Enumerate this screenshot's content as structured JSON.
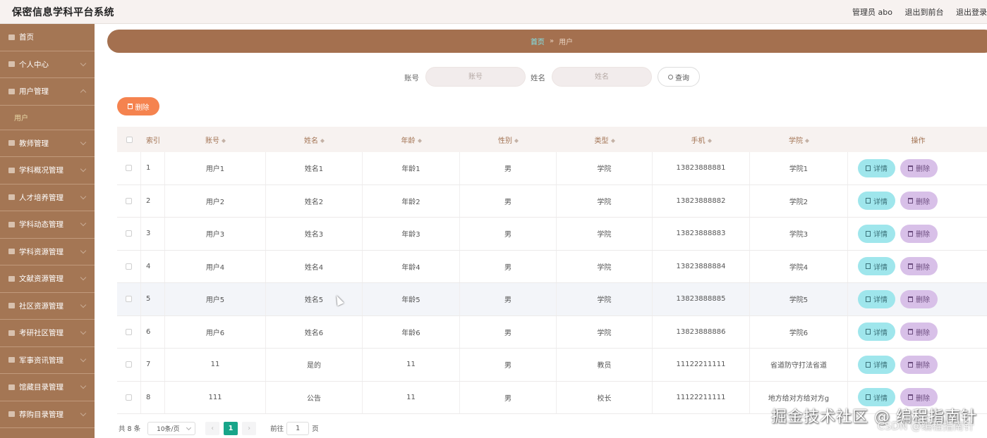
{
  "app": {
    "title": "保密信息学科平台系统",
    "admin": "管理员 abo",
    "back_front": "退出到前台",
    "logout": "退出登录"
  },
  "sidebar": {
    "items": [
      {
        "label": "首页",
        "icon": "home-icon"
      },
      {
        "label": "个人中心",
        "icon": "user-icon"
      },
      {
        "label": "用户管理",
        "icon": "grid-icon"
      },
      {
        "label": "教师管理",
        "icon": "card-icon"
      },
      {
        "label": "学科概况管理",
        "icon": "grid-icon"
      },
      {
        "label": "人才培养管理",
        "icon": "settings-icon"
      },
      {
        "label": "学科动态管理",
        "icon": "list-icon"
      },
      {
        "label": "学科资源管理",
        "icon": "list-icon"
      },
      {
        "label": "文献资源管理",
        "icon": "chart-icon"
      },
      {
        "label": "社区资源管理",
        "icon": "grid-icon"
      },
      {
        "label": "考研社区管理",
        "icon": "grid-icon"
      },
      {
        "label": "军事资讯管理",
        "icon": "chart-icon"
      },
      {
        "label": "馆藏目录管理",
        "icon": "settings-icon"
      },
      {
        "label": "荐购目录管理",
        "icon": "settings-icon"
      }
    ],
    "sub_item": "用户"
  },
  "breadcrumb": {
    "home": "首页",
    "current": "用户"
  },
  "search": {
    "account_label": "账号",
    "account_placeholder": "账号",
    "name_label": "姓名",
    "name_placeholder": "姓名",
    "query_button": "查询"
  },
  "toolbar": {
    "delete_label": "删除"
  },
  "table": {
    "headers": [
      "索引",
      "账号",
      "姓名",
      "年龄",
      "性别",
      "类型",
      "手机",
      "学院",
      "操作"
    ],
    "rows": [
      {
        "idx": "1",
        "account": "用户1",
        "name": "姓名1",
        "age": "年龄1",
        "gender": "男",
        "type": "学院",
        "phone": "13823888881",
        "college": "学院1"
      },
      {
        "idx": "2",
        "account": "用户2",
        "name": "姓名2",
        "age": "年龄2",
        "gender": "男",
        "type": "学院",
        "phone": "13823888882",
        "college": "学院2"
      },
      {
        "idx": "3",
        "account": "用户3",
        "name": "姓名3",
        "age": "年龄3",
        "gender": "男",
        "type": "学院",
        "phone": "13823888883",
        "college": "学院3"
      },
      {
        "idx": "4",
        "account": "用户4",
        "name": "姓名4",
        "age": "年龄4",
        "gender": "男",
        "type": "学院",
        "phone": "13823888884",
        "college": "学院4"
      },
      {
        "idx": "5",
        "account": "用户5",
        "name": "姓名5",
        "age": "年龄5",
        "gender": "男",
        "type": "学院",
        "phone": "13823888885",
        "college": "学院5"
      },
      {
        "idx": "6",
        "account": "用户6",
        "name": "姓名6",
        "age": "年龄6",
        "gender": "男",
        "type": "学院",
        "phone": "13823888886",
        "college": "学院6"
      },
      {
        "idx": "7",
        "account": "11",
        "name": "是的",
        "age": "11",
        "gender": "男",
        "type": "教员",
        "phone": "11122211111",
        "college": "省道防守打法省道"
      },
      {
        "idx": "8",
        "account": "111",
        "name": "公告",
        "age": "11",
        "gender": "男",
        "type": "校长",
        "phone": "11122211111",
        "college": "地方给对方给对方g"
      }
    ],
    "detail_label": "详情",
    "delete_label": "删除"
  },
  "pagination": {
    "total": "共 8 条",
    "page_size": "10条/页",
    "current_page": "1",
    "goto_label": "前往",
    "goto_value": "1",
    "page_suffix": "页"
  },
  "watermark": {
    "line1": "掘金技术社区 @ 编程指南针",
    "line2": "CSDN @编程指南针"
  }
}
